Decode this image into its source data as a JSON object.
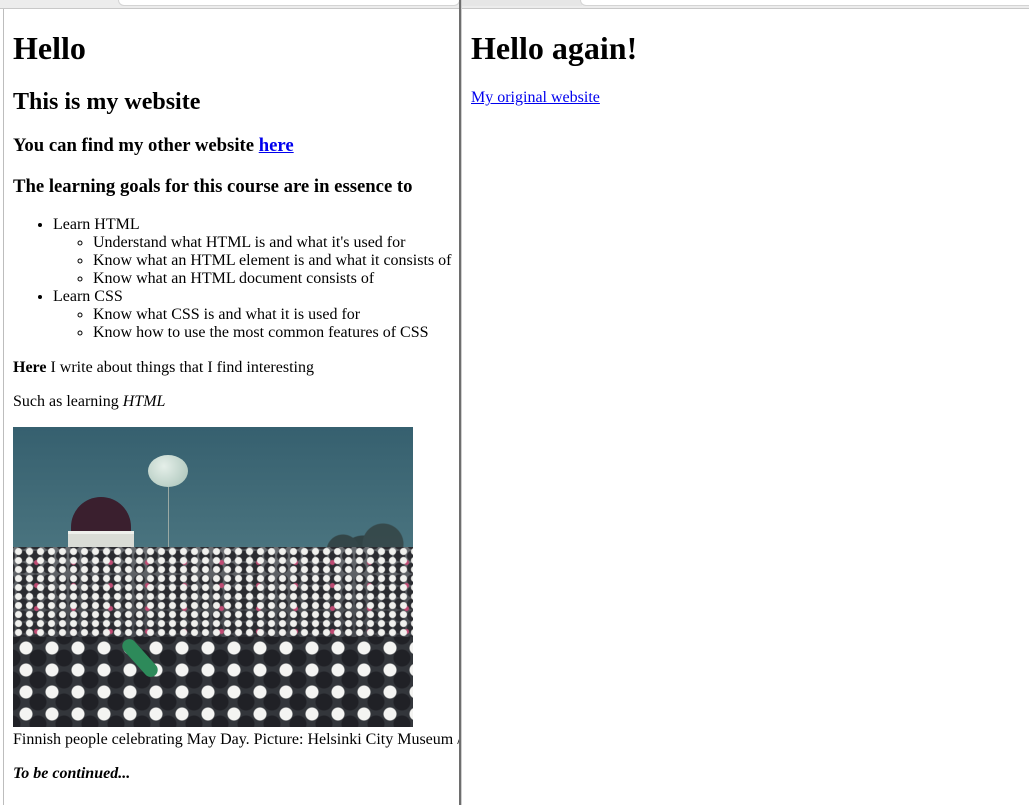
{
  "left_page": {
    "h1": "Hello",
    "h2": "This is my website",
    "other_site": {
      "text": "You can find my other website ",
      "link": "here"
    },
    "goals_heading": "The learning goals for this course are in essence to",
    "goals": [
      {
        "label": "Learn HTML",
        "items": [
          "Understand what HTML is and what it's used for",
          "Know what an HTML element is and what it consists of",
          "Know what an HTML document consists of"
        ]
      },
      {
        "label": "Learn CSS",
        "items": [
          "Know what CSS is and what it is used for",
          "Know how to use the most common features of CSS"
        ]
      }
    ],
    "para1_bold": "Here",
    "para1_rest": " I write about things that I find interesting",
    "para2_text": "Such as learning ",
    "para2_italic": "HTML",
    "image_caption": "Finnish people celebrating May Day. Picture: Helsinki City Museum /",
    "to_be_continued": "To be continued..."
  },
  "right_page": {
    "h1": "Hello again!",
    "link": "My original website"
  },
  "colors": {
    "link": "#0000ee",
    "text": "#000000",
    "divider": "#6e6e6e"
  }
}
